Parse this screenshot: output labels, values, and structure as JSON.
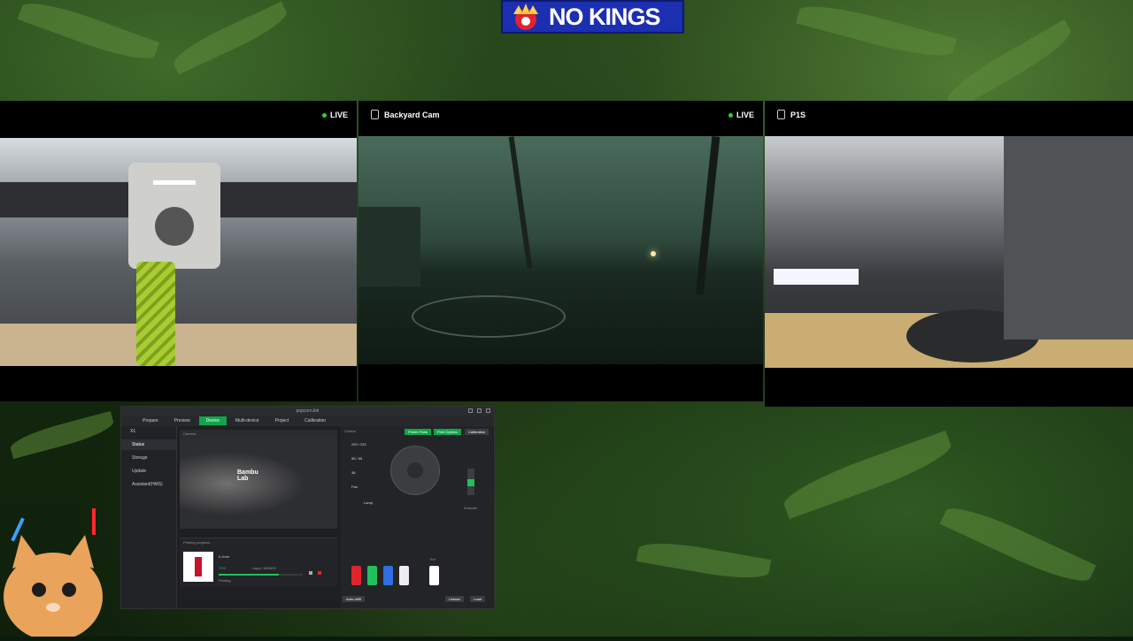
{
  "banner": {
    "text": "NO KINGS",
    "colors": {
      "bg": "#1c2fb0",
      "crown": "#e0242c"
    }
  },
  "cameras": [
    {
      "title": "",
      "live_label": "LIVE",
      "icon": "printer-cam-icon"
    },
    {
      "title": "Backyard Cam",
      "live_label": "LIVE",
      "icon": "phone-cam-icon"
    },
    {
      "title": "P1S",
      "live_label": "",
      "icon": "phone-cam-icon"
    }
  ],
  "app": {
    "window_title": "popcorn.kiri",
    "tabs": [
      "Prepare",
      "Preview",
      "Device",
      "Multi-device",
      "Project",
      "Calibration"
    ],
    "active_tab": "Device",
    "printer_name": "X1",
    "sidebar": [
      "Status",
      "Storage",
      "Update",
      "Assistant(HMS)"
    ],
    "camera_label": "Camera",
    "brand": [
      "Bambu",
      "Lab"
    ],
    "printing_progress_label": "Printing progress",
    "job_name": "0.2mm",
    "progress_percent": 72,
    "layer_text": "Layer: 463/600",
    "status_text": "Printing",
    "remaining_text": "",
    "control_label": "Control",
    "buttons": [
      "Printer Parts",
      "Print Options",
      "Calibration"
    ],
    "temps": [
      "220 / 220",
      "55 / 55",
      "38"
    ],
    "fan_label": "Fan",
    "lamp_label": "Lamp",
    "extruder_label": "Extruder",
    "ams_label": "Ext",
    "bottom_buttons": [
      "Unload",
      "Load"
    ],
    "auto_refill": "Auto-refill",
    "spool_colors": [
      "#e0242c",
      "#22c05a",
      "#2f6ee0",
      "#eeeeee",
      "#ffffff"
    ]
  }
}
